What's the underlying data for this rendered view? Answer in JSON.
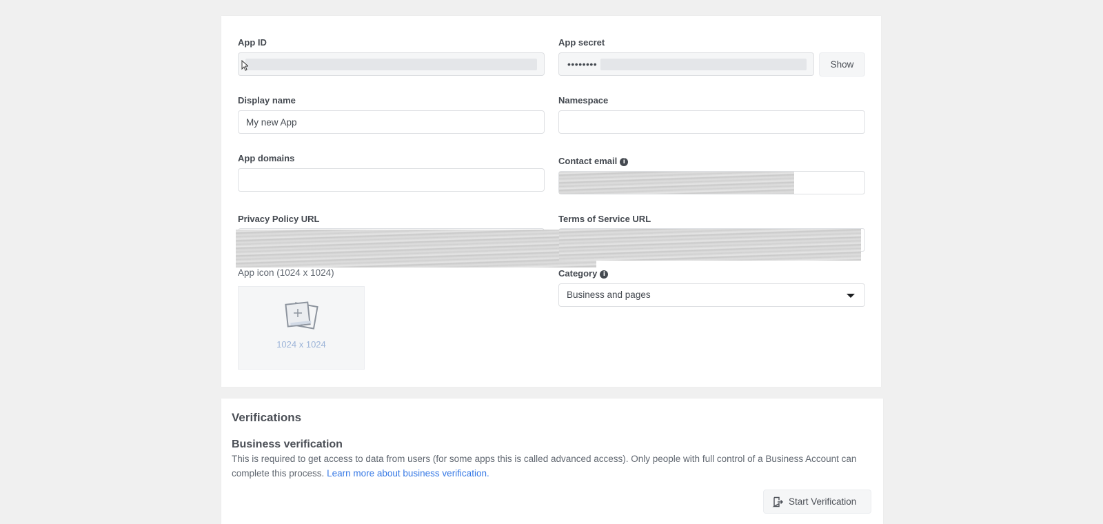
{
  "basic": {
    "app_id": {
      "label": "App ID",
      "value": ""
    },
    "app_secret": {
      "label": "App secret",
      "value": "••••••••",
      "show_label": "Show"
    },
    "display_name": {
      "label": "Display name",
      "value": "My new App"
    },
    "namespace": {
      "label": "Namespace",
      "value": ""
    },
    "app_domains": {
      "label": "App domains",
      "value": ""
    },
    "contact_email": {
      "label": "Contact email",
      "info_icon": "info-icon"
    },
    "privacy_policy_url": {
      "label": "Privacy Policy URL"
    },
    "terms_of_service_url": {
      "label": "Terms of Service URL"
    },
    "app_icon": {
      "label": "App icon (1024 x 1024)",
      "size_text": "1024 x 1024",
      "icon": "add-image-icon"
    },
    "category": {
      "label": "Category",
      "value": "Business and pages",
      "info_icon": "info-icon",
      "chevron": "chevron-down-icon"
    }
  },
  "verifications": {
    "title": "Verifications",
    "business": {
      "title": "Business verification",
      "description": "This is required to get access to data from users (for some apps this is called advanced access). Only people with full control of a Business Account can complete this process.",
      "link": "Learn more about business verification.",
      "button_label": "Start Verification",
      "button_icon": "door-exit-icon"
    }
  },
  "colors": {
    "link": "#3578e5",
    "background": "#f0f0f0",
    "card": "#ffffff"
  }
}
